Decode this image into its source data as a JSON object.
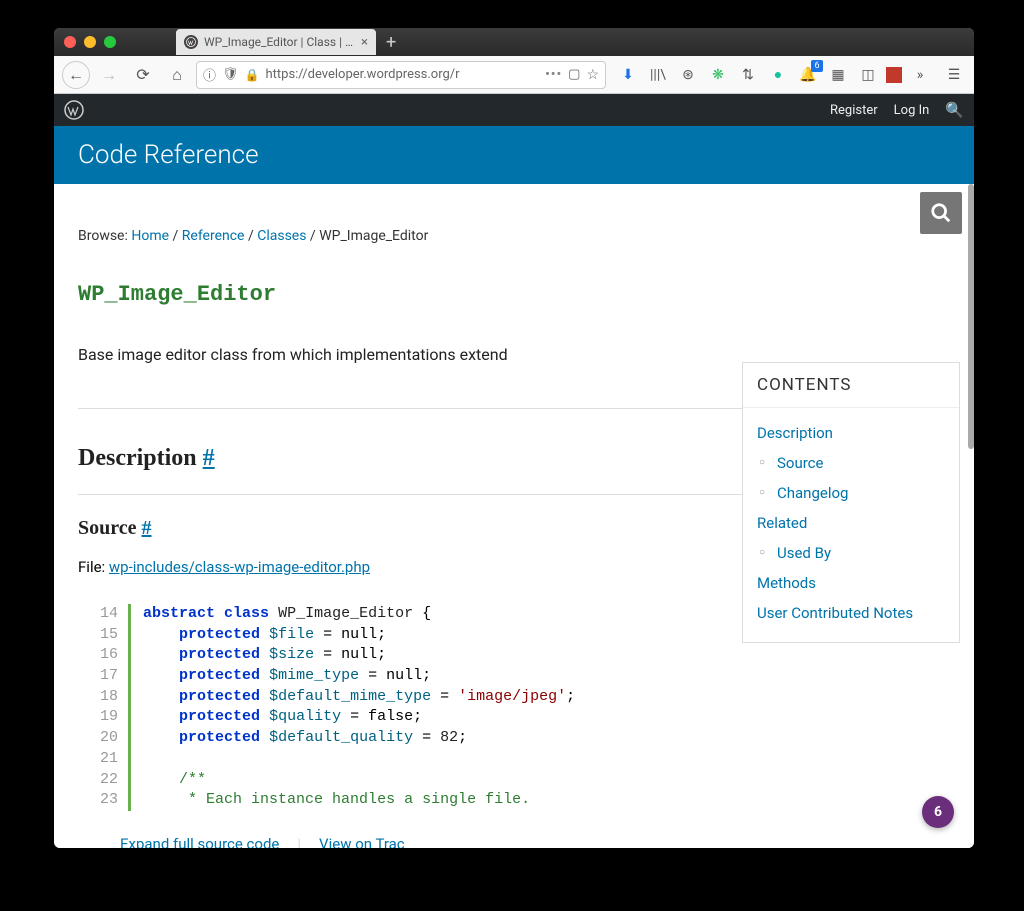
{
  "browser": {
    "tab_title": "WP_Image_Editor | Class | Word",
    "url_display": "https://developer.wordpress.org/r",
    "bell_badge": "6"
  },
  "wpbar": {
    "register": "Register",
    "login": "Log In"
  },
  "banner": {
    "title": "Code Reference"
  },
  "breadcrumb": {
    "browse_label": "Browse:",
    "home": "Home",
    "reference": "Reference",
    "classes": "Classes",
    "current": "WP_Image_Editor",
    "sep": " / "
  },
  "page": {
    "h1": "WP_Image_Editor",
    "summary": "Base image editor class from which implementations extend",
    "description_heading": "Description",
    "source_heading": "Source",
    "hash": "#",
    "file_label": "File: ",
    "file_link": "wp-includes/class-wp-image-editor.php",
    "expand_link": "Expand full source code",
    "trac_link": "View on Trac"
  },
  "code": {
    "line_start": 14,
    "line_end": 23,
    "lines": [
      {
        "n": 14,
        "html": "<span class='kw'>abstract class</span> <span class='cls'>WP_Image_Editor</span> {"
      },
      {
        "n": 15,
        "html": "    <span class='kw2'>protected</span> <span class='var'>$file</span> = null;"
      },
      {
        "n": 16,
        "html": "    <span class='kw2'>protected</span> <span class='var'>$size</span> = null;"
      },
      {
        "n": 17,
        "html": "    <span class='kw2'>protected</span> <span class='var'>$mime_type</span> = null;"
      },
      {
        "n": 18,
        "html": "    <span class='kw2'>protected</span> <span class='var'>$default_mime_type</span> = <span class='str'>'image/jpeg'</span>;"
      },
      {
        "n": 19,
        "html": "    <span class='kw2'>protected</span> <span class='var'>$quality</span> = false;"
      },
      {
        "n": 20,
        "html": "    <span class='kw2'>protected</span> <span class='var'>$default_quality</span> = <span class='num'>82</span>;"
      },
      {
        "n": 21,
        "html": ""
      },
      {
        "n": 22,
        "html": "    <span class='cmt'>/**</span>"
      },
      {
        "n": 23,
        "html": "    <span class='cmt'> * Each instance handles a single file.</span>"
      }
    ]
  },
  "toc": {
    "heading": "CONTENTS",
    "items": [
      {
        "label": "Description",
        "sub": false
      },
      {
        "label": "Source",
        "sub": true
      },
      {
        "label": "Changelog",
        "sub": true
      },
      {
        "label": "Related",
        "sub": false
      },
      {
        "label": "Used By",
        "sub": true
      },
      {
        "label": "Methods",
        "sub": false
      },
      {
        "label": "User Contributed Notes",
        "sub": false
      }
    ]
  },
  "purple_badge": "6"
}
